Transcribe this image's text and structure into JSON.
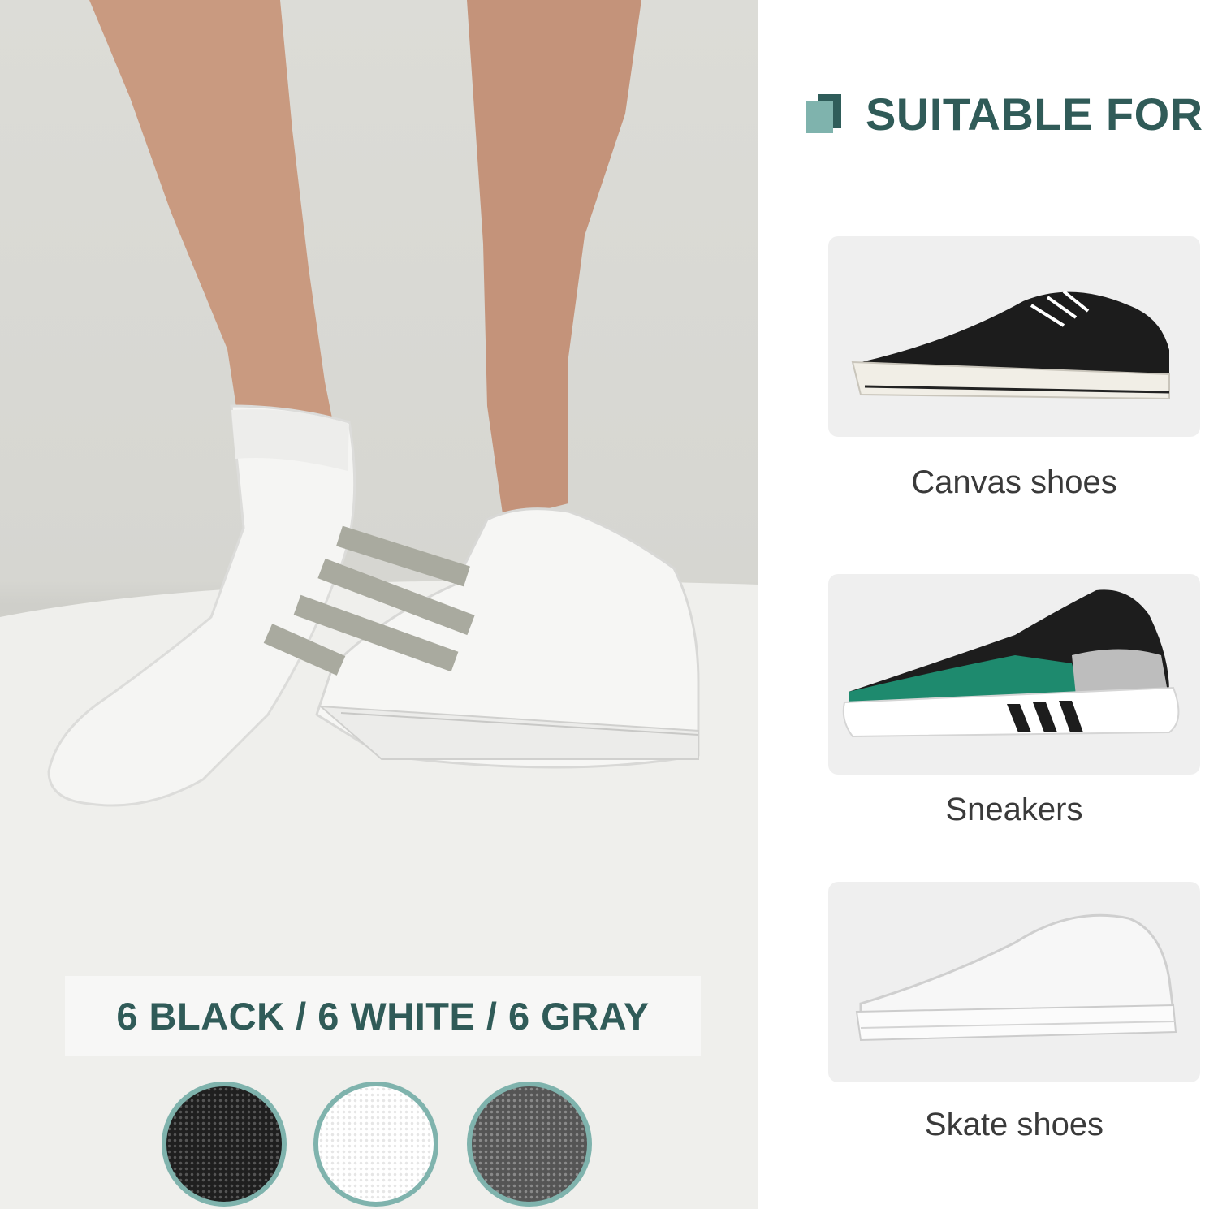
{
  "heading": {
    "title": "SUITABLE FOR",
    "icon": "square-mark-icon"
  },
  "shoes": [
    {
      "label": "Canvas shoes",
      "icon": "canvas-shoe-image"
    },
    {
      "label": "Sneakers",
      "icon": "sneaker-image"
    },
    {
      "label": "Skate shoes",
      "icon": "skate-shoe-image"
    }
  ],
  "colors": {
    "banner": "6 BLACK / 6 WHITE / 6 GRAY",
    "swatches": [
      {
        "name": "black",
        "hex": "#222222"
      },
      {
        "name": "white",
        "hex": "#ffffff"
      },
      {
        "name": "gray",
        "hex": "#5a5a5a"
      }
    ]
  },
  "palette": {
    "accent": "#305b58",
    "accent_light": "#7fb3ad",
    "card_bg": "#efefef"
  }
}
